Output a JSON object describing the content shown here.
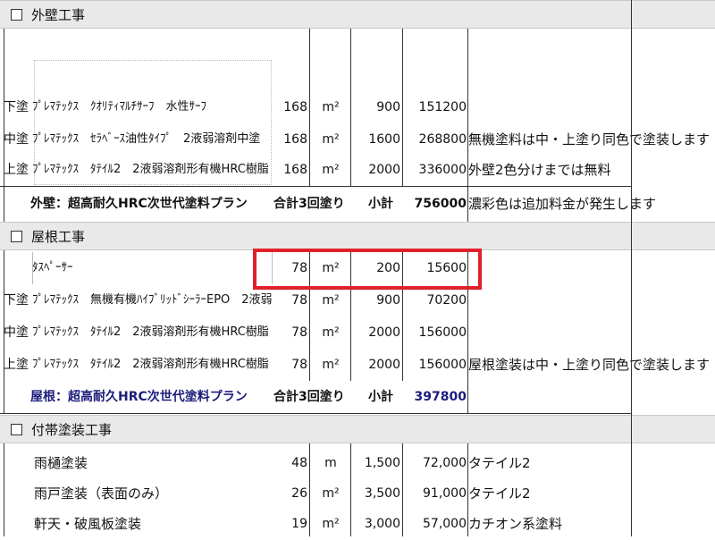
{
  "sections": {
    "exterior": "外壁工事",
    "roof": "屋根工事",
    "extra": "付帯塗装工事"
  },
  "exterior_rows": [
    {
      "label": "下塗",
      "item": "ﾌﾟﾚﾏﾃｯｸｽ　ｸｵﾘﾃｨﾏﾙﾁｻｰﾌ　水性ｻｰﾌ",
      "qty": "168",
      "unit": "m²",
      "price": "900",
      "subtotal": "151200",
      "note": ""
    },
    {
      "label": "中塗",
      "item": "ﾌﾟﾚﾏﾃｯｸｽ　ｾﾗﾍﾞｰｽ油性ﾀｲﾌﾟ　2液弱溶剤中塗",
      "qty": "168",
      "unit": "m²",
      "price": "1600",
      "subtotal": "268800",
      "note": "無機塗料は中・上塗り同色で塗装します"
    },
    {
      "label": "上塗",
      "item": "ﾌﾟﾚﾏﾃｯｸｽ　ﾀﾃｲﾙ2　2液弱溶剤形有機HRC樹脂",
      "qty": "168",
      "unit": "m²",
      "price": "2000",
      "subtotal": "336000",
      "note": "外壁2色分けまでは無料"
    }
  ],
  "exterior_summary": {
    "plan": "外壁：超高耐久HRC次世代塗料プラン",
    "total_label": "合計3回塗り",
    "subtotal_label": "小計",
    "subtotal": "756000",
    "note": "濃彩色は追加料金が発生します"
  },
  "roof_rows": [
    {
      "label": "",
      "item": "ﾀｽﾍﾟｰｻｰ",
      "qty": "78",
      "unit": "m²",
      "price": "200",
      "subtotal": "15600",
      "note": ""
    },
    {
      "label": "下塗",
      "item": "ﾌﾟﾚﾏﾃｯｸｽ　無機有機ﾊｲﾌﾞﾘｯﾄﾞｼｰﾗｰEPO　2液弱",
      "qty": "78",
      "unit": "m²",
      "price": "900",
      "subtotal": "70200",
      "note": ""
    },
    {
      "label": "中塗",
      "item": "ﾌﾟﾚﾏﾃｯｸｽ　ﾀﾃｲﾙ2　2液弱溶剤形有機HRC樹脂",
      "qty": "78",
      "unit": "m²",
      "price": "2000",
      "subtotal": "156000",
      "note": ""
    },
    {
      "label": "上塗",
      "item": "ﾌﾟﾚﾏﾃｯｸｽ　ﾀﾃｲﾙ2　2液弱溶剤形有機HRC樹脂",
      "qty": "78",
      "unit": "m²",
      "price": "2000",
      "subtotal": "156000",
      "note": "屋根塗装は中・上塗り同色で塗装します"
    }
  ],
  "roof_summary": {
    "plan": "屋根：超高耐久HRC次世代塗料プラン",
    "total_label": "合計3回塗り",
    "subtotal_label": "小計",
    "subtotal": "397800"
  },
  "extra_rows": [
    {
      "item": "雨樋塗装",
      "qty": "48",
      "unit": "m",
      "price": "1,500",
      "subtotal": "72,000",
      "note": "タテイル2"
    },
    {
      "item": "雨戸塗装（表面のみ）",
      "qty": "26",
      "unit": "m²",
      "price": "3,500",
      "subtotal": "91,000",
      "note": "タテイル2"
    },
    {
      "item": "軒天・破風板塗装",
      "qty": "19",
      "unit": "m²",
      "price": "3,000",
      "subtotal": "57,000",
      "note": "カチオン系塗料"
    }
  ],
  "colors": {
    "highlight": "#e0202a",
    "summary_blue": "#1c1c7a",
    "header_bg": "#e9e9e9"
  }
}
